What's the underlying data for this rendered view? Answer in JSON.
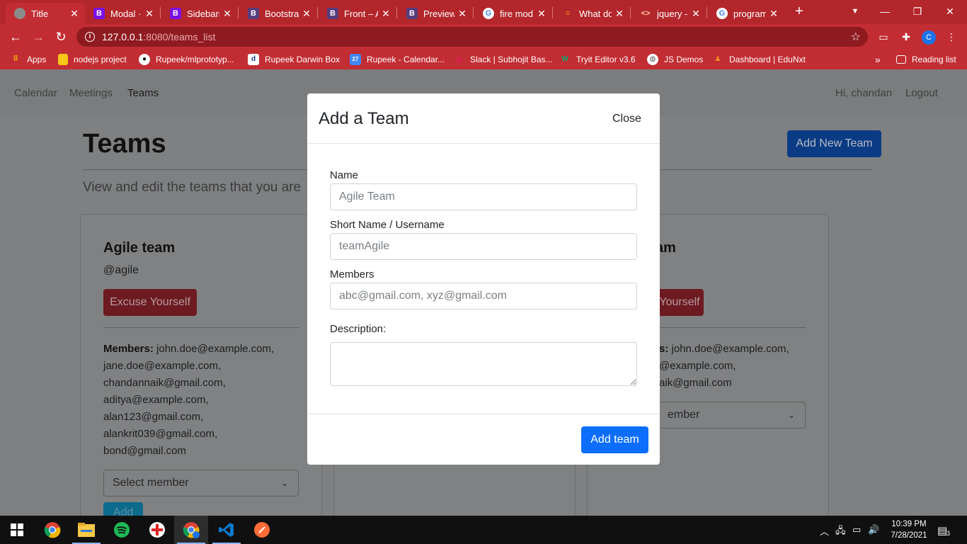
{
  "browser": {
    "tabs": [
      {
        "label": "Title",
        "icon": "globe-icon",
        "active": true
      },
      {
        "label": "Modal · I",
        "icon": "bootstrap-icon"
      },
      {
        "label": "Sidebars",
        "icon": "bootstrap-icon"
      },
      {
        "label": "Bootstra",
        "icon": "bootstrap-icon"
      },
      {
        "label": "Front – A",
        "icon": "bootstrap-icon"
      },
      {
        "label": "Preview",
        "icon": "bootstrap-icon"
      },
      {
        "label": "fire mod",
        "icon": "google-icon"
      },
      {
        "label": "What do",
        "icon": "stackoverflow-icon"
      },
      {
        "label": "jquery -",
        "icon": "code-icon"
      },
      {
        "label": "program",
        "icon": "google-icon"
      }
    ],
    "tab_close": "✕",
    "new_tab": "+",
    "url_host": "127.0.0.1",
    "url_rest": ":8080/teams_list",
    "profile_initial": "C",
    "bookmarks": [
      {
        "label": "Apps",
        "icon": "apps-grid-icon"
      },
      {
        "label": "nodejs project",
        "icon": "folder-icon"
      },
      {
        "label": "Rupeek/mlprototyp...",
        "icon": "github-icon"
      },
      {
        "label": "Rupeek Darwin Box",
        "icon": "darwinbox-icon"
      },
      {
        "label": "Rupeek - Calendar...",
        "icon": "calendar-icon"
      },
      {
        "label": "Slack | Subhojit Bas...",
        "icon": "slack-icon"
      },
      {
        "label": "Tryit Editor v3.6",
        "icon": "w3schools-icon"
      },
      {
        "label": "JS Demos",
        "icon": "globe-icon"
      },
      {
        "label": "Dashboard | EduNxt",
        "icon": "edunxt-icon"
      }
    ],
    "bookmarks_overflow": "»",
    "reading_list": "Reading list"
  },
  "app": {
    "nav": {
      "calendar": "Calendar",
      "meetings": "Meetings",
      "teams": "Teams",
      "greeting": "Hi, chandan",
      "logout": "Logout"
    },
    "page_title": "Teams",
    "page_subtitle": "View and edit the teams that you are",
    "add_new_team": "Add New Team",
    "cards": [
      {
        "title": "Agile team",
        "handle": "@agile",
        "excuse_label": "Excuse Yourself",
        "members_label": "Members:",
        "members": "john.doe@example.com, jane.doe@example.com, chandannaik@gmail.com, aditya@example.com, alan123@gmail.com, alankrit039@gmail.com, bond@gmail.com",
        "select_placeholder": "Select member",
        "add_label": "Add"
      },
      {
        "title": "am",
        "excuse_label": "Yourself",
        "members_label": "s:",
        "members": "john.doe@example.com, @example.com, aik@gmail.com",
        "select_placeholder": "ember"
      }
    ]
  },
  "modal": {
    "title": "Add a Team",
    "close": "Close",
    "fields": {
      "name_label": "Name",
      "name_placeholder": "Agile Team",
      "short_label": "Short Name / Username",
      "short_placeholder": "teamAgile",
      "members_label": "Members",
      "members_placeholder": "abc@gmail.com, xyz@gmail.com",
      "description_label": "Description:"
    },
    "submit": "Add team"
  },
  "taskbar": {
    "apps": [
      "windows-start-icon",
      "chrome-icon",
      "file-explorer-icon",
      "spotify-icon",
      "red-app-icon",
      "chrome-profile-icon",
      "vscode-icon",
      "postman-icon"
    ],
    "time": "10:39 PM",
    "date": "7/28/2021",
    "notification_count": "3"
  }
}
